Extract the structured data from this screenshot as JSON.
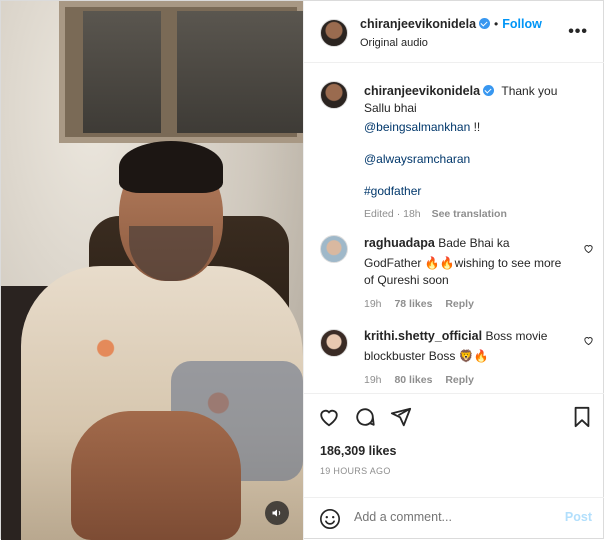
{
  "header": {
    "username": "chiranjeevikonidela",
    "follow_label": "Follow",
    "subtitle": "Original audio",
    "separator": "•"
  },
  "caption": {
    "username": "chiranjeevikonidela",
    "line1": "Thank you",
    "line2": "Sallu bhai",
    "mention1": "@beingsalmankhan",
    "mention1_suffix": " !!",
    "mention2": "@alwaysramcharan",
    "hashtag": "#godfather",
    "edited": "Edited",
    "time": "18h",
    "see_translation": "See translation"
  },
  "comments": [
    {
      "username": "raghuadapa",
      "text_line1": "Bade Bhai ka",
      "text_line2": "GodFather 🔥🔥wishing to see more",
      "text_line3": "of Qureshi soon",
      "time": "19h",
      "likes": "78 likes",
      "reply": "Reply"
    },
    {
      "username": "krithi.shetty_official",
      "text_line1": "Boss movie",
      "text_line2": "blockbuster Boss 🦁🔥",
      "time": "19h",
      "likes": "80 likes",
      "reply": "Reply"
    }
  ],
  "actions": {
    "likes": "186,309 likes",
    "posted": "19 HOURS AGO"
  },
  "add_comment": {
    "placeholder": "Add a comment...",
    "post_label": "Post"
  },
  "colors": {
    "accent": "#0095f6",
    "verified": "#3897f0",
    "muted": "#8e8e8e",
    "post_disabled": "#b2dffc"
  },
  "icons": {
    "like": "heart-icon",
    "comment": "comment-icon",
    "share": "share-icon",
    "save": "bookmark-icon",
    "more": "more-options-icon",
    "audio": "speaker-icon",
    "emoji": "emoji-icon"
  }
}
